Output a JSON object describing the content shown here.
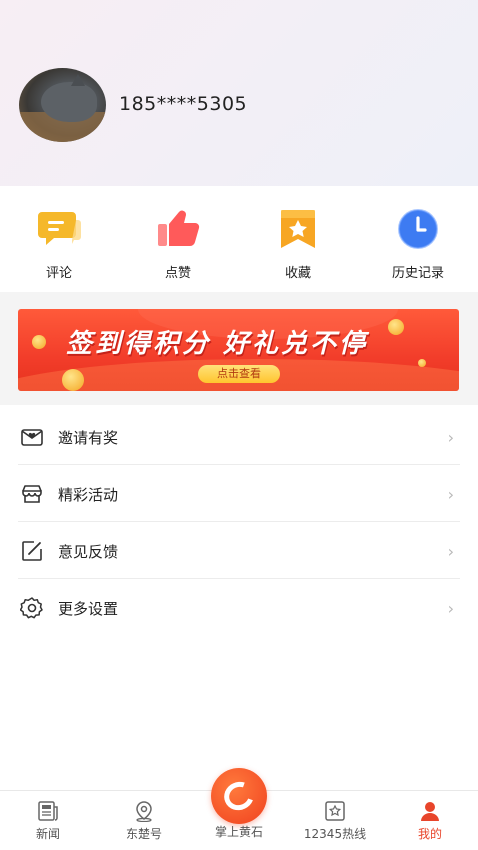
{
  "profile": {
    "phone": "185****5305"
  },
  "quick_actions": [
    {
      "label": "评论",
      "icon": "comment-bubble-icon",
      "color": "#f5b82a"
    },
    {
      "label": "点赞",
      "icon": "thumbs-up-icon",
      "color": "#ff5a5a"
    },
    {
      "label": "收藏",
      "icon": "bookmark-star-icon",
      "color": "#f7a623"
    },
    {
      "label": "历史记录",
      "icon": "clock-icon",
      "color": "#3d7bf2"
    }
  ],
  "banner": {
    "title": "签到得积分 好礼兑不停",
    "button": "点击查看"
  },
  "menu": [
    {
      "label": "邀请有奖",
      "icon": "envelope-icon"
    },
    {
      "label": "精彩活动",
      "icon": "store-icon"
    },
    {
      "label": "意见反馈",
      "icon": "edit-icon"
    },
    {
      "label": "更多设置",
      "icon": "gear-icon"
    }
  ],
  "tabbar": {
    "tabs": [
      {
        "label": "新闻",
        "icon": "news-icon"
      },
      {
        "label": "东楚号",
        "icon": "location-pin-icon"
      },
      {
        "label": "掌上黄石",
        "icon": "app-logo-icon"
      },
      {
        "label": "12345热线",
        "icon": "hotline-icon"
      },
      {
        "label": "我的",
        "icon": "user-icon",
        "active": true
      }
    ]
  },
  "colors": {
    "accent": "#e8452b",
    "banner_red": "#f23d2a",
    "separator": "#f4f4f4"
  }
}
